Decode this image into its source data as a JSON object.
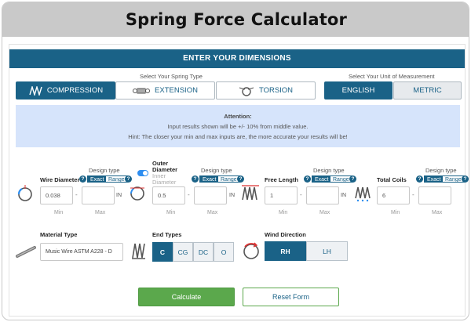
{
  "window": {
    "title": "Spring Force Calculator"
  },
  "card": {
    "heading": "ENTER YOUR DIMENSIONS"
  },
  "spring_type": {
    "label": "Select Your Spring Type",
    "options": [
      {
        "label": "COMPRESSION",
        "selected": true
      },
      {
        "label": "EXTENSION",
        "selected": false
      },
      {
        "label": "TORSION",
        "selected": false
      }
    ]
  },
  "unit": {
    "label": "Select Your Unit of Measurement",
    "options": [
      {
        "label": "ENGLISH",
        "selected": true
      },
      {
        "label": "METRIC",
        "selected": false
      }
    ]
  },
  "attention": {
    "title": "Attention:",
    "line1": "Input results shown will be +/- 10% from middle value.",
    "line2": "Hint: The closer your min and max inputs are, the more accurate your results will be!"
  },
  "fields": [
    {
      "label": "Wire Diameter",
      "design_type": "Design type",
      "exact": "Exact",
      "range": "Range",
      "min_value": "0.038",
      "unit": "IN",
      "min": "Min",
      "max": "Max"
    },
    {
      "label": "Outer Diameter",
      "alt_label": "Inner Diameter",
      "design_type": "Design type",
      "exact": "Exact",
      "range": "Range",
      "min_value": "0.5",
      "unit": "IN",
      "min": "Min",
      "max": "Max"
    },
    {
      "label": "Free Length",
      "design_type": "Design type",
      "exact": "Exact",
      "range": "Range",
      "min_value": "1",
      "unit": "IN",
      "min": "Min",
      "max": "Max"
    },
    {
      "label": "Total Coils",
      "design_type": "Design type",
      "exact": "Exact",
      "range": "Range",
      "min_value": "6",
      "min": "Min",
      "max": "Max"
    }
  ],
  "material": {
    "label": "Material Type",
    "value": "Music Wire ASTM A228 - D"
  },
  "end_types": {
    "label": "End Types",
    "options": [
      "C",
      "CG",
      "DC",
      "O"
    ],
    "selected": "C"
  },
  "wind": {
    "label": "Wind Direction",
    "options": [
      "RH",
      "LH"
    ],
    "selected": "RH"
  },
  "actions": {
    "calculate": "Calculate",
    "reset": "Reset Form"
  },
  "colors": {
    "primary": "#1a6287",
    "calculate": "#5ba84c",
    "attention_bg": "#d6e4fb",
    "titlebar": "#c9c9c9"
  }
}
